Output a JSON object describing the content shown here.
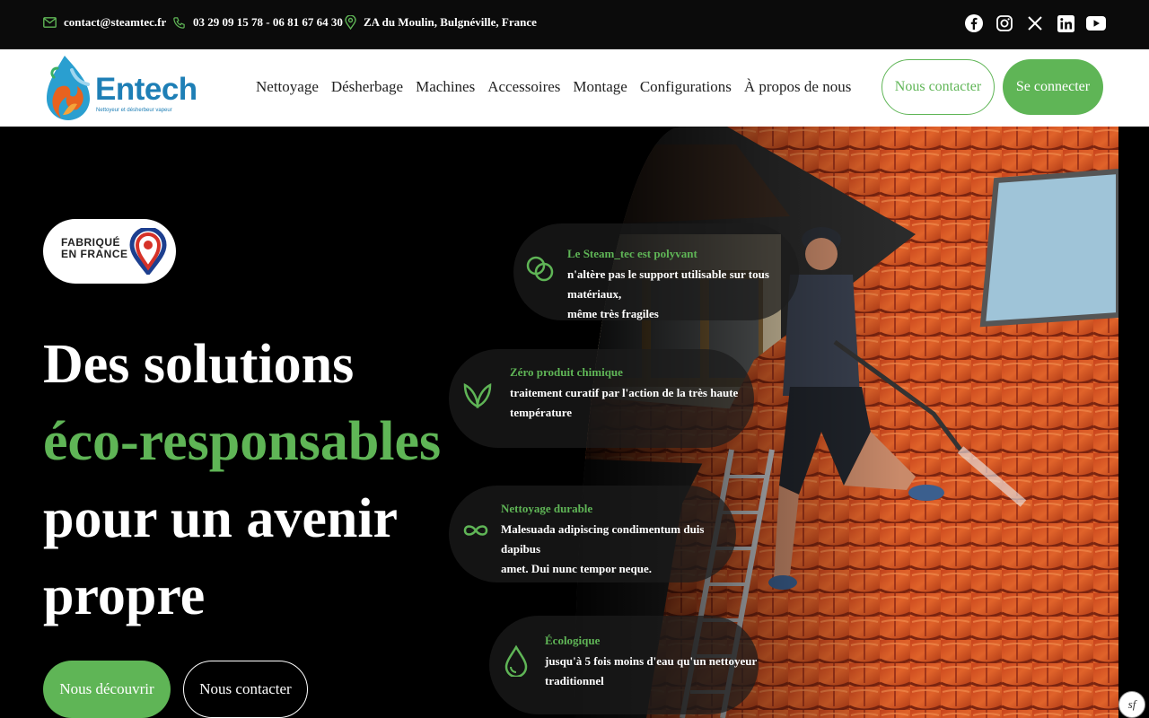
{
  "topbar": {
    "email": "contact@steamtec.fr",
    "phone": "03 29 09 15 78 - 06 81 67 64 30",
    "address": "ZA du Moulin, Bulgnéville, France",
    "socials": [
      "facebook-icon",
      "instagram-icon",
      "x-icon",
      "linkedin-icon",
      "youtube-icon"
    ]
  },
  "brand": {
    "name": "Entech",
    "tagline": "Nettoyeur et désherbeur vapeur"
  },
  "nav": {
    "items": [
      "Nettoyage",
      "Désherbage",
      "Machines",
      "Accessoires",
      "Montage",
      "Configurations",
      "À propos de nous"
    ],
    "contact_label": "Nous contacter",
    "login_label": "Se connecter"
  },
  "hero": {
    "badge_line1": "FABRIQUÉ",
    "badge_line2": "EN FRANCE",
    "headline_1": "Des solutions",
    "headline_2": "éco-responsables",
    "headline_3": "pour un avenir",
    "headline_4": "propre",
    "discover_label": "Nous découvrir",
    "contact_label": "Nous contacter"
  },
  "features": [
    {
      "icon": "rings-icon",
      "title": "Le Steam_tec est polyvant",
      "line1": "n'altère pas le support utilisable sur tous matériaux,",
      "line2": "même très fragiles"
    },
    {
      "icon": "leaves-icon",
      "title": "Zéro produit chimique",
      "line1": "traitement curatif par l'action de la très haute",
      "line2": "température"
    },
    {
      "icon": "infinity-icon",
      "title": "Nettoyage durable",
      "line1": "Malesuada adipiscing condimentum duis dapibus",
      "line2": "amet. Dui nunc tempor neque."
    },
    {
      "icon": "water-drop-icon",
      "title": "Écologique",
      "line1": "jusqu'à 5 fois moins d'eau qu'un nettoyeur",
      "line2": "traditionnel"
    }
  ],
  "colors": {
    "accent": "#5fb556",
    "brand_blue": "#1e7fb6",
    "dark": "#000000"
  },
  "sf_badge": "sf"
}
